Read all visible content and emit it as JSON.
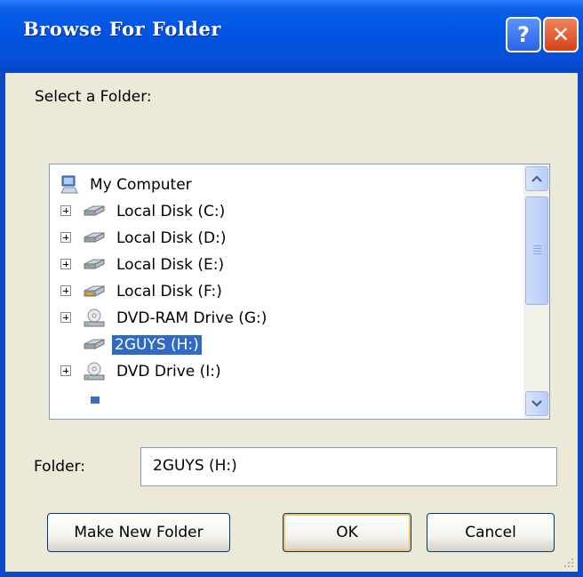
{
  "dialog": {
    "title": "Browse For Folder",
    "help_label": "?",
    "close_label": "✕",
    "prompt": "Select a Folder:"
  },
  "tree": {
    "root": {
      "label": "My Computer",
      "icon": "my-computer-icon"
    },
    "items": [
      {
        "label": "Local Disk (C:)",
        "icon": "hard-drive-icon",
        "expandable": true,
        "selected": false
      },
      {
        "label": "Local Disk (D:)",
        "icon": "hard-drive-icon",
        "expandable": true,
        "selected": false
      },
      {
        "label": "Local Disk (E:)",
        "icon": "hard-drive-icon",
        "expandable": true,
        "selected": false
      },
      {
        "label": "Local Disk (F:)",
        "icon": "removable-drive-icon",
        "expandable": true,
        "selected": false
      },
      {
        "label": "DVD-RAM Drive (G:)",
        "icon": "dvd-drive-icon",
        "expandable": true,
        "selected": false
      },
      {
        "label": "2GUYS (H:)",
        "icon": "hard-drive-icon",
        "expandable": false,
        "selected": true
      },
      {
        "label": "DVD Drive (I:)",
        "icon": "dvd-drive-icon",
        "expandable": true,
        "selected": false
      }
    ],
    "selection_color": "#316ac5"
  },
  "folder": {
    "label": "Folder:",
    "value": "2GUYS (H:)"
  },
  "buttons": {
    "make_new_folder": "Make New Folder",
    "ok": "OK",
    "cancel": "Cancel"
  },
  "colors": {
    "titlebar": "#0055e5",
    "face": "#ece9d8",
    "close": "#d5421a"
  }
}
